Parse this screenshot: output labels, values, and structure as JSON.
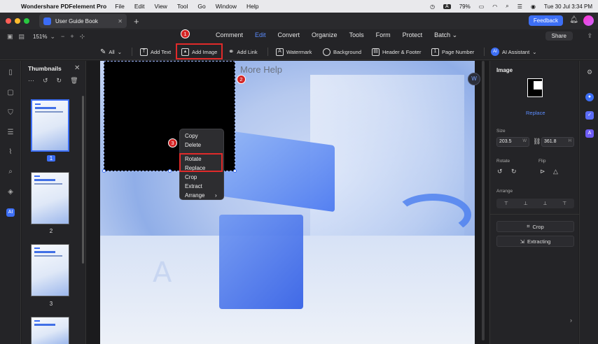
{
  "menubar": {
    "app_name": "Wondershare PDFelement Pro",
    "items": [
      "File",
      "Edit",
      "View",
      "Tool",
      "Go",
      "Window",
      "Help"
    ],
    "input_badge": "A",
    "battery": "79%",
    "datetime": "Tue 30 Jul 3:34 PM"
  },
  "tabbar": {
    "doc_title": "User Guide Book",
    "add_label": "+",
    "feedback_label": "Feedback"
  },
  "navrow": {
    "zoom": "151%",
    "tabs": [
      "Comment",
      "Edit",
      "Convert",
      "Organize",
      "Tools",
      "Form",
      "Protect",
      "Batch"
    ],
    "active_tab": "Edit",
    "share_label": "Share"
  },
  "edit_tools": {
    "all_label": "All",
    "add_text": "Add Text",
    "add_image": "Add Image",
    "add_link": "Add Link",
    "watermark": "Watermark",
    "background": "Background",
    "header_footer": "Header & Footer",
    "page_number": "Page Number",
    "ai_assistant": "AI Assistant",
    "ai_badge": "AI"
  },
  "left_rail": {
    "ai_label": "AI"
  },
  "thumbnails": {
    "title": "Thumbnails",
    "pages": [
      {
        "number": "1",
        "selected": true
      },
      {
        "number": "2",
        "selected": false
      },
      {
        "number": "3",
        "selected": false
      }
    ]
  },
  "page": {
    "heading": "More Help"
  },
  "context_menu": {
    "items": [
      "Copy",
      "Delete",
      "Rotate",
      "Replace",
      "Crop",
      "Extract",
      "Arrange"
    ],
    "submenu_arrow": "›"
  },
  "callouts": [
    "1",
    "2",
    "3"
  ],
  "properties": {
    "title": "Image",
    "replace_label": "Replace",
    "size_label": "Size",
    "width": "203.5",
    "width_unit": "W",
    "height": "361.8",
    "height_unit": "H",
    "rotate_label": "Rotate",
    "flip_label": "Flip",
    "arrange_label": "Arrange",
    "crop_label": "Crop",
    "extracting_label": "Extracting"
  },
  "right_rail": {
    "badge": "A"
  },
  "colors": {
    "accent": "#3d6ff5",
    "callout_red": "#d42424",
    "panel_bg": "#242427"
  }
}
